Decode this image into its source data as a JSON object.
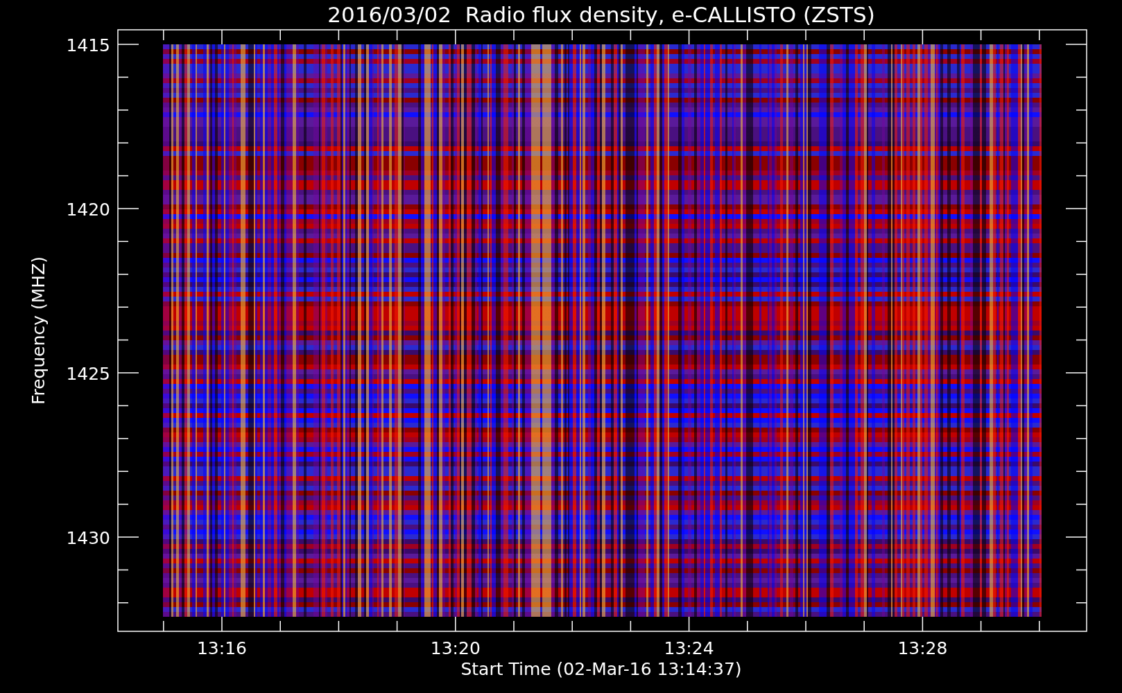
{
  "title": "2016/03/02  Radio flux density, e-CALLISTO (ZSTS)",
  "y_axis": {
    "label": "Frequency (MHZ)",
    "ticks": [
      "1415",
      "1420",
      "1425",
      "1430"
    ]
  },
  "x_axis": {
    "label": "Start Time (02-Mar-16 13:14:37)",
    "ticks": [
      "13:16",
      "13:20",
      "13:24",
      "13:28"
    ]
  }
}
